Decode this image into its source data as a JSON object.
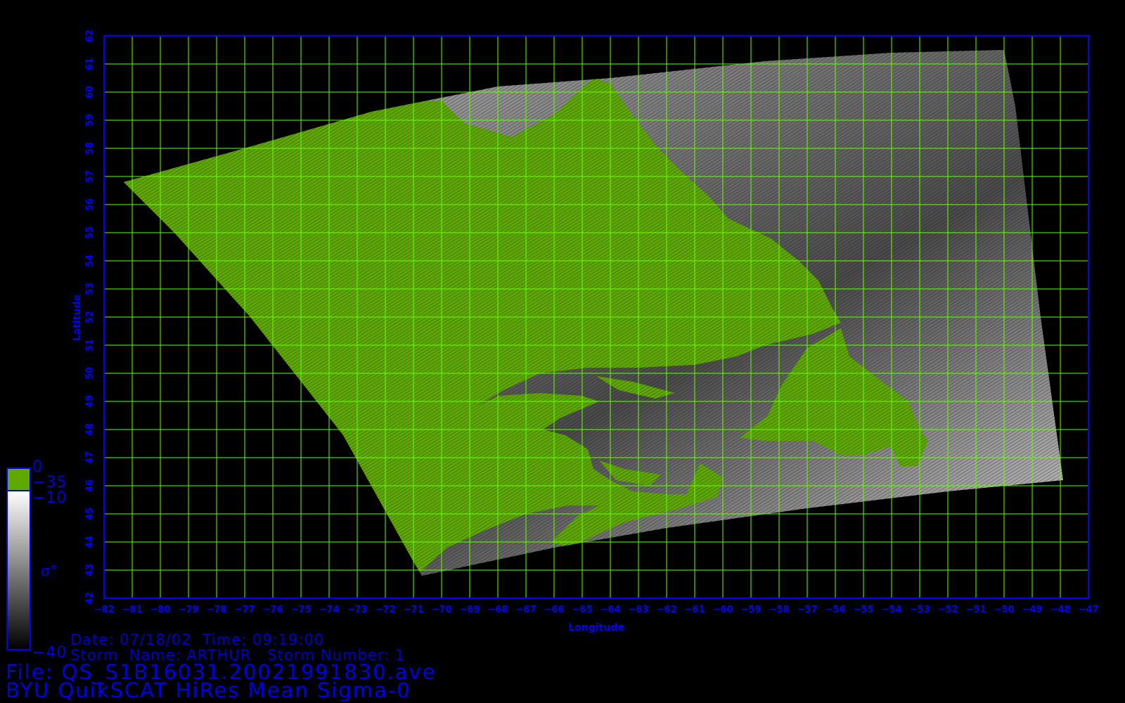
{
  "map": {
    "xlabel": "Longitude",
    "ylabel": "Latitude",
    "lon_range": [
      -82,
      -47
    ],
    "lat_range": [
      42,
      62
    ],
    "lon_ticks": [
      -82,
      -81,
      -80,
      -79,
      -78,
      -77,
      -76,
      -75,
      -74,
      -73,
      -72,
      -71,
      -70,
      -69,
      -68,
      -67,
      -66,
      -65,
      -64,
      -63,
      -62,
      -61,
      -60,
      -59,
      -58,
      -57,
      -56,
      -55,
      -54,
      -53,
      -52,
      -51,
      -50,
      -49,
      -48,
      -47
    ],
    "lat_ticks": [
      42,
      43,
      44,
      45,
      46,
      47,
      48,
      49,
      50,
      51,
      52,
      53,
      54,
      55,
      56,
      57,
      58,
      59,
      60,
      61,
      62
    ],
    "grid": true,
    "colors": {
      "grid": "#66ff00",
      "frame": "#0000ff",
      "labels": "#0000ff",
      "land": "#5fa800",
      "swath_dark": "#2a2a2a",
      "swath_light": "#d8d8d8"
    }
  },
  "colorbar": {
    "symbol": "σ°",
    "land_top": "0",
    "land_bottom": "−35",
    "ocean_top": "−10",
    "ocean_bottom": "−40"
  },
  "info": {
    "date_line": "Date: 07/18/02  Time: 09:19:00",
    "storm_line": "Storm  Name: ARTHUR   Storm Number: 1",
    "file_line": "File: QS_S1B16031.20021991830.ave",
    "product_line": "BYU QuikSCAT HiRes Mean Sigma-0"
  }
}
